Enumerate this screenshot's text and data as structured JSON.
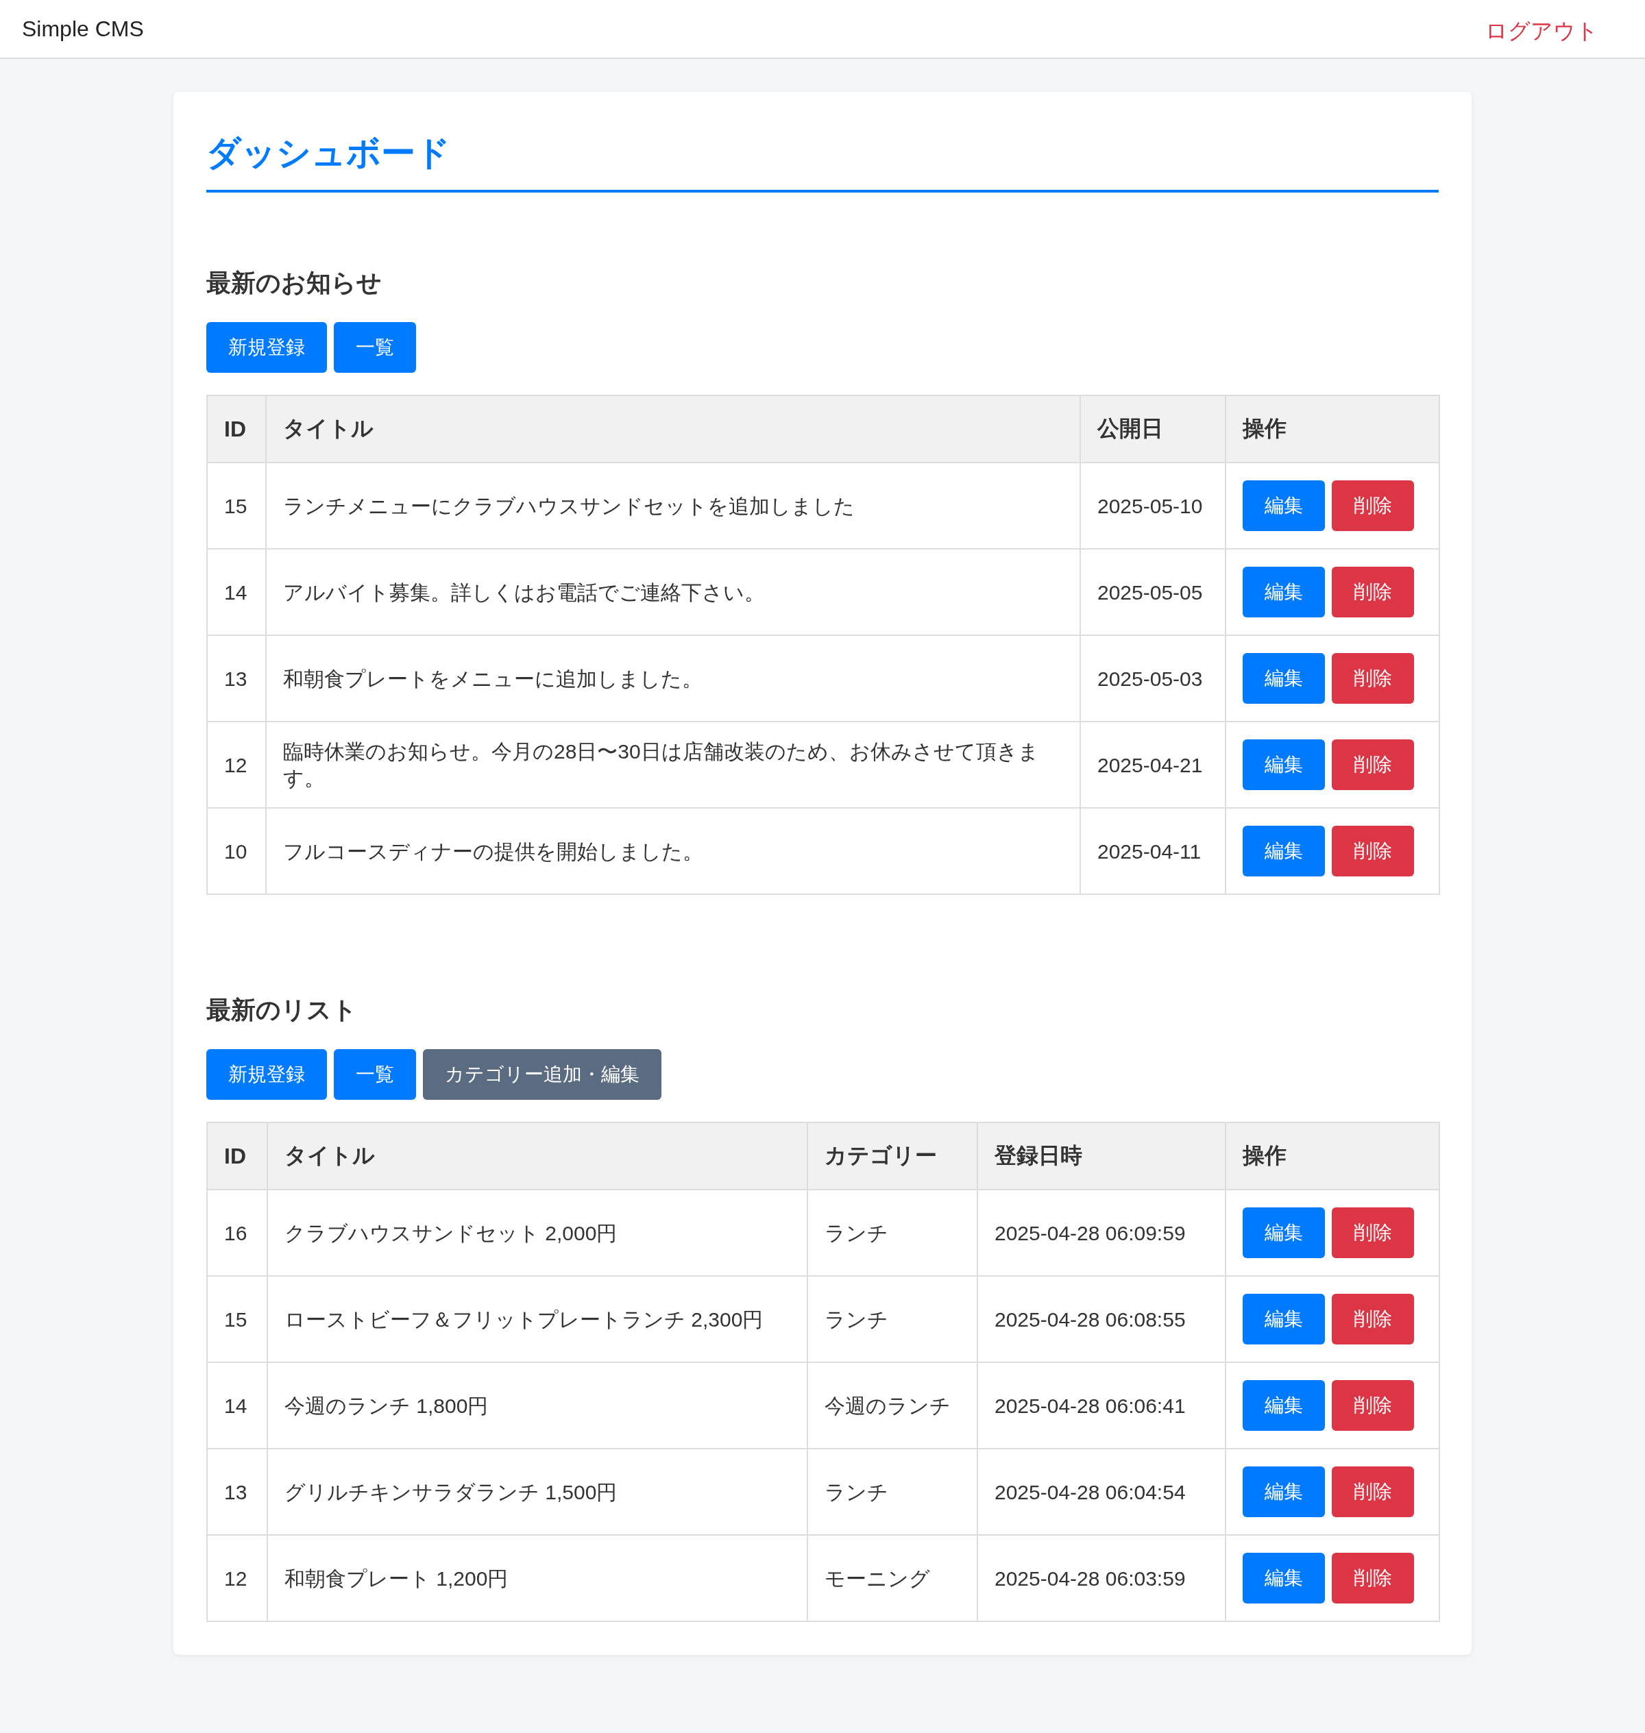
{
  "header": {
    "brand": "Simple CMS",
    "logout": "ログアウト"
  },
  "page_title": "ダッシュボード",
  "sections": [
    {
      "heading": "最新のお知らせ",
      "actions": [
        {
          "label": "新規登録",
          "kind": "primary"
        },
        {
          "label": "一覧",
          "kind": "primary"
        }
      ],
      "columns": [
        "ID",
        "タイトル",
        "公開日",
        "操作"
      ],
      "rows": [
        {
          "cells": [
            "15",
            "ランチメニューにクラブハウスサンドセットを追加しました",
            "2025-05-10"
          ],
          "buttons": [
            {
              "label": "編集",
              "kind": "primary"
            },
            {
              "label": "削除",
              "kind": "danger"
            }
          ]
        },
        {
          "cells": [
            "14",
            "アルバイト募集。詳しくはお電話でご連絡下さい。",
            "2025-05-05"
          ],
          "buttons": [
            {
              "label": "編集",
              "kind": "primary"
            },
            {
              "label": "削除",
              "kind": "danger"
            }
          ]
        },
        {
          "cells": [
            "13",
            "和朝食プレートをメニューに追加しました。",
            "2025-05-03"
          ],
          "buttons": [
            {
              "label": "編集",
              "kind": "primary"
            },
            {
              "label": "削除",
              "kind": "danger"
            }
          ]
        },
        {
          "cells": [
            "12",
            "臨時休業のお知らせ。今月の28日〜30日は店舗改装のため、お休みさせて頂きます。",
            "2025-04-21"
          ],
          "buttons": [
            {
              "label": "編集",
              "kind": "primary"
            },
            {
              "label": "削除",
              "kind": "danger"
            }
          ]
        },
        {
          "cells": [
            "10",
            "フルコースディナーの提供を開始しました。",
            "2025-04-11"
          ],
          "buttons": [
            {
              "label": "編集",
              "kind": "primary"
            },
            {
              "label": "削除",
              "kind": "danger"
            }
          ]
        }
      ]
    },
    {
      "heading": "最新のリスト",
      "actions": [
        {
          "label": "新規登録",
          "kind": "primary"
        },
        {
          "label": "一覧",
          "kind": "primary"
        },
        {
          "label": "カテゴリー追加・編集",
          "kind": "secondary"
        }
      ],
      "columns": [
        "ID",
        "タイトル",
        "カテゴリー",
        "登録日時",
        "操作"
      ],
      "rows": [
        {
          "cells": [
            "16",
            "クラブハウスサンドセット 2,000円",
            "ランチ",
            "2025-04-28 06:09:59"
          ],
          "buttons": [
            {
              "label": "編集",
              "kind": "primary"
            },
            {
              "label": "削除",
              "kind": "danger"
            }
          ]
        },
        {
          "cells": [
            "15",
            "ローストビーフ＆フリットプレートランチ 2,300円",
            "ランチ",
            "2025-04-28 06:08:55"
          ],
          "buttons": [
            {
              "label": "編集",
              "kind": "primary"
            },
            {
              "label": "削除",
              "kind": "danger"
            }
          ]
        },
        {
          "cells": [
            "14",
            "今週のランチ 1,800円",
            "今週のランチ",
            "2025-04-28 06:06:41"
          ],
          "buttons": [
            {
              "label": "編集",
              "kind": "primary"
            },
            {
              "label": "削除",
              "kind": "danger"
            }
          ]
        },
        {
          "cells": [
            "13",
            "グリルチキンサラダランチ 1,500円",
            "ランチ",
            "2025-04-28 06:04:54"
          ],
          "buttons": [
            {
              "label": "編集",
              "kind": "primary"
            },
            {
              "label": "削除",
              "kind": "danger"
            }
          ]
        },
        {
          "cells": [
            "12",
            "和朝食プレート 1,200円",
            "モーニング",
            "2025-04-28 06:03:59"
          ],
          "buttons": [
            {
              "label": "編集",
              "kind": "primary"
            },
            {
              "label": "削除",
              "kind": "danger"
            }
          ]
        }
      ]
    }
  ]
}
